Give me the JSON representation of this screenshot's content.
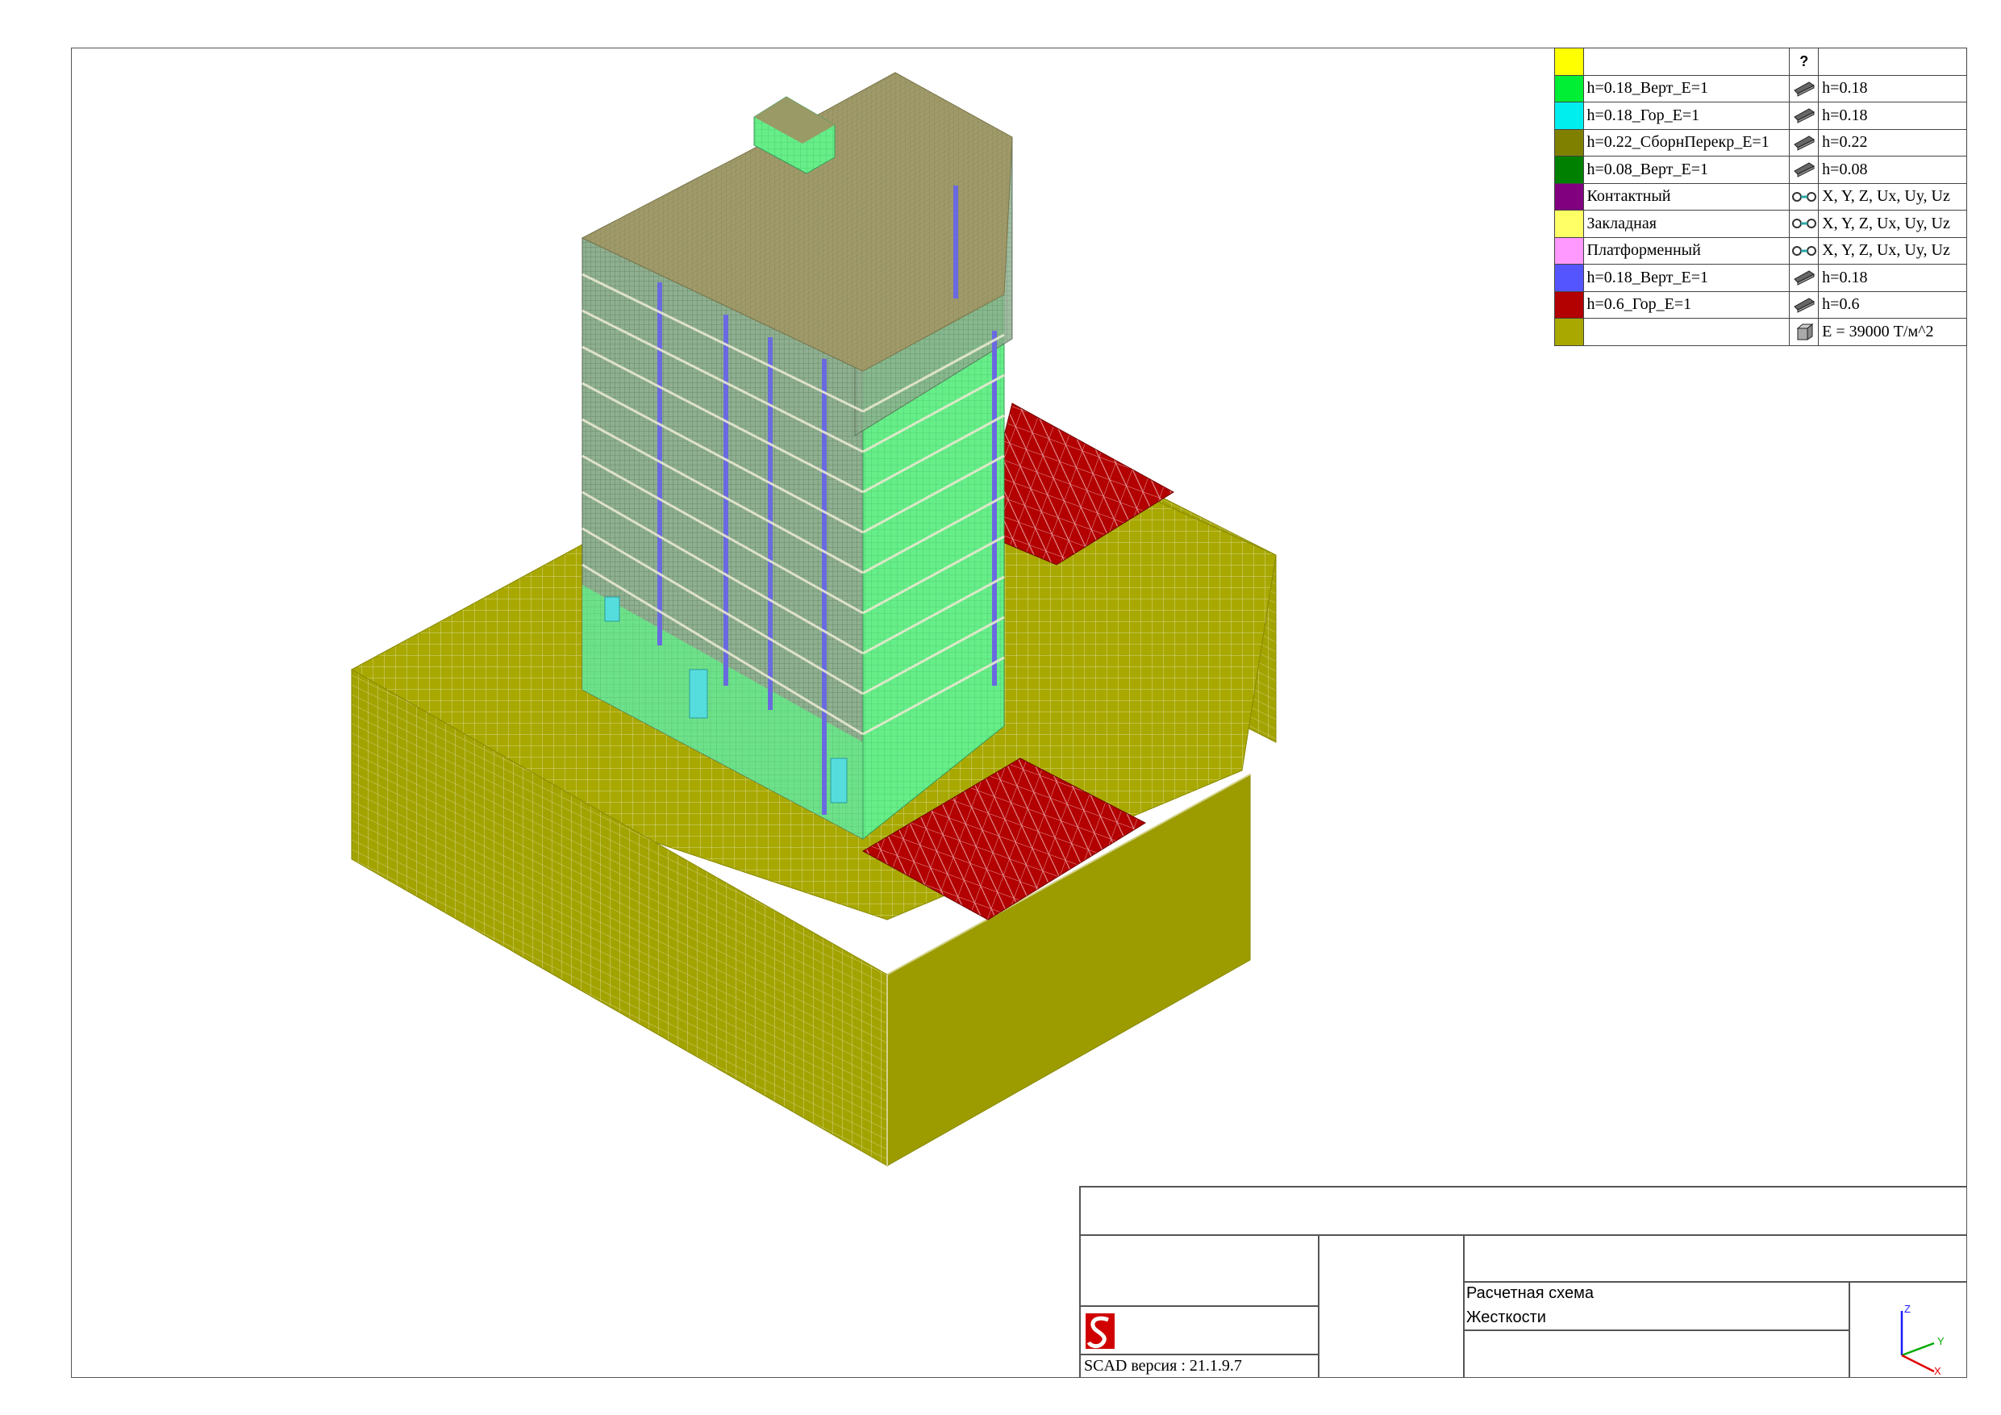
{
  "app": {
    "version_text": "SCAD версия : 21.1.9.7"
  },
  "legend": {
    "header_mark": "?",
    "rows": [
      {
        "color": "#00ee33",
        "name": "h=0.18_Верт_E=1",
        "icon": "plate-icon",
        "prop": "h=0.18"
      },
      {
        "color": "#00eeee",
        "name": "h=0.18_Гор_E=1",
        "icon": "plate-icon",
        "prop": "h=0.18"
      },
      {
        "color": "#808000",
        "name": "h=0.22_СборнПерекр_E=1",
        "icon": "plate-icon",
        "prop": "h=0.22"
      },
      {
        "color": "#008000",
        "name": "h=0.08_Верт_E=1",
        "icon": "plate-icon",
        "prop": "h=0.08"
      },
      {
        "color": "#800080",
        "name": "Контактный",
        "icon": "link-icon",
        "prop": "X, Y, Z, Ux, Uy, Uz"
      },
      {
        "color": "#ffff66",
        "name": "Закладная",
        "icon": "link-icon",
        "prop": "X, Y, Z, Ux, Uy, Uz"
      },
      {
        "color": "#ff99ff",
        "name": "Платформенный",
        "icon": "link-icon",
        "prop": "X, Y, Z, Ux, Uy, Uz"
      },
      {
        "color": "#5555ff",
        "name": "h=0.18_Верт_E=1",
        "icon": "plate-icon",
        "prop": "h=0.18"
      },
      {
        "color": "#b30000",
        "name": "h=0.6_Гор_E=1",
        "icon": "plate-icon",
        "prop": "h=0.6"
      },
      {
        "color": "#a8a800",
        "name": "",
        "icon": "solid-icon",
        "prop": "E = 39000 Т/м^2"
      }
    ],
    "header_color": "#ffff00"
  },
  "title_block": {
    "scheme_label": "Расчетная схема",
    "mode_label": "Жесткости"
  },
  "axes": {
    "x": "X",
    "y": "Y",
    "z": "Z"
  },
  "colors": {
    "soil": "#a8a800",
    "soil_side": "#9a9a00",
    "slab": "#b30000",
    "wall": "#66ee88",
    "floor": "#a09a6a",
    "column": "#8888ff",
    "window": "#55dddd"
  }
}
